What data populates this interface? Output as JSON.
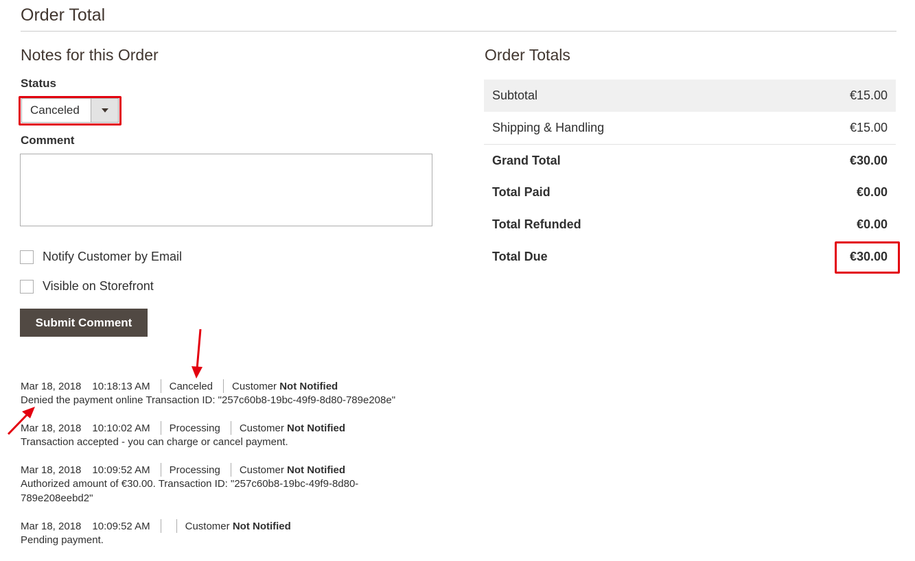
{
  "header": {
    "title": "Order Total"
  },
  "notes": {
    "title": "Notes for this Order",
    "status_label": "Status",
    "status_value": "Canceled",
    "comment_label": "Comment",
    "comment_value": "",
    "notify_label": "Notify Customer by Email",
    "notify_checked": false,
    "visible_label": "Visible on Storefront",
    "visible_checked": false,
    "submit_label": "Submit Comment"
  },
  "totals": {
    "title": "Order Totals",
    "rows": [
      {
        "label": "Subtotal",
        "value": "€15.00"
      },
      {
        "label": "Shipping & Handling",
        "value": "€15.00"
      },
      {
        "label": "Grand Total",
        "value": "€30.00"
      },
      {
        "label": "Total Paid",
        "value": "€0.00"
      },
      {
        "label": "Total Refunded",
        "value": "€0.00"
      },
      {
        "label": "Total Due",
        "value": "€30.00"
      }
    ]
  },
  "history": [
    {
      "date": "Mar 18, 2018",
      "time": "10:18:13 AM",
      "status": "Canceled",
      "customer": "Customer",
      "notified": "Not Notified",
      "comment": "Denied the payment online Transaction ID: \"257c60b8-19bc-49f9-8d80-789e208e\""
    },
    {
      "date": "Mar 18, 2018",
      "time": "10:10:02 AM",
      "status": "Processing",
      "customer": "Customer",
      "notified": "Not Notified",
      "comment": "Transaction accepted - you can charge or cancel payment."
    },
    {
      "date": "Mar 18, 2018",
      "time": "10:09:52 AM",
      "status": "Processing",
      "customer": "Customer",
      "notified": "Not Notified",
      "comment": "Authorized amount of €30.00. Transaction ID: \"257c60b8-19bc-49f9-8d80-789e208eebd2\""
    },
    {
      "date": "Mar 18, 2018",
      "time": "10:09:52 AM",
      "status": "",
      "customer": "Customer",
      "notified": "Not Notified",
      "comment": "Pending payment."
    }
  ],
  "colors": {
    "highlight": "#e3000f",
    "button": "#514943",
    "heading": "#41362f"
  }
}
